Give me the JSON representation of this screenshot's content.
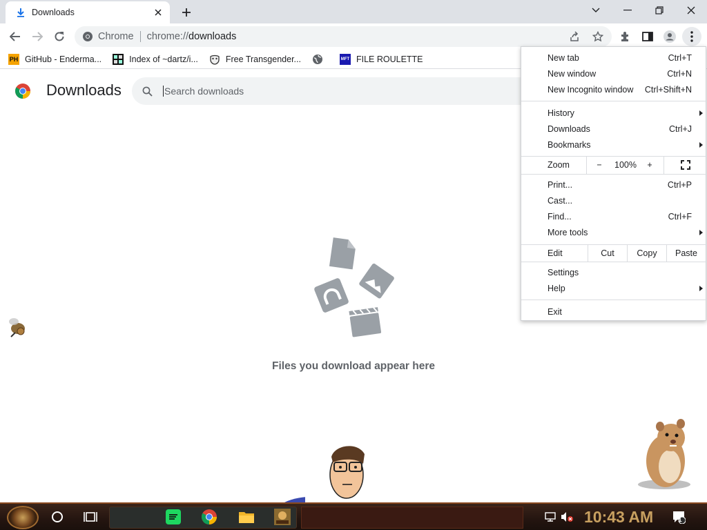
{
  "tab": {
    "title": "Downloads",
    "close": "✕"
  },
  "new_tab_symbol": "+",
  "window_controls": {
    "minimize": "—",
    "maximize": "❐",
    "close": "✕",
    "tab_search": "⌄"
  },
  "omnibox": {
    "site_label": "Chrome",
    "url_scheme": "chrome://",
    "url_host": "downloads"
  },
  "bookmarks": [
    {
      "label": "GitHub - Enderma...",
      "icon": "PH-icon"
    },
    {
      "label": "Index of ~dartz/i...",
      "icon": "index-icon"
    },
    {
      "label": "Free Transgender...",
      "icon": "mask-icon"
    },
    {
      "label": "",
      "icon": "globe-icon"
    },
    {
      "label": "FILE ROULETTE",
      "icon": "mft-icon"
    }
  ],
  "bookmark_icon_text": {
    "ph": "PH",
    "mft": "MFT"
  },
  "page": {
    "title": "Downloads",
    "search_placeholder": "Search downloads",
    "empty_message": "Files you download appear here"
  },
  "menu": {
    "new_tab": {
      "label": "New tab",
      "shortcut": "Ctrl+T"
    },
    "new_window": {
      "label": "New window",
      "shortcut": "Ctrl+N"
    },
    "new_incognito": {
      "label": "New Incognito window",
      "shortcut": "Ctrl+Shift+N"
    },
    "history": {
      "label": "History"
    },
    "downloads": {
      "label": "Downloads",
      "shortcut": "Ctrl+J"
    },
    "bookmarks": {
      "label": "Bookmarks"
    },
    "zoom": {
      "label": "Zoom",
      "minus": "−",
      "value": "100%",
      "plus": "+"
    },
    "print": {
      "label": "Print...",
      "shortcut": "Ctrl+P"
    },
    "cast": {
      "label": "Cast..."
    },
    "find": {
      "label": "Find...",
      "shortcut": "Ctrl+F"
    },
    "more_tools": {
      "label": "More tools"
    },
    "edit": {
      "label": "Edit",
      "cut": "Cut",
      "copy": "Copy",
      "paste": "Paste"
    },
    "settings": {
      "label": "Settings"
    },
    "help": {
      "label": "Help"
    },
    "exit": {
      "label": "Exit"
    }
  },
  "taskbar": {
    "clock": "10:43 AM",
    "notification_count": "1"
  },
  "colors": {
    "accent": "#1a73e8",
    "tab_strip": "#dee1e6",
    "omnibox": "#f1f3f4",
    "clock": "#c8a060"
  }
}
